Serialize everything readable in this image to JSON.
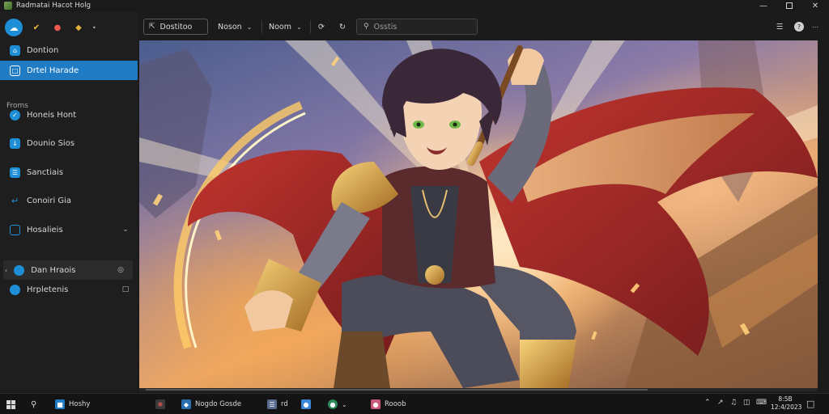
{
  "window": {
    "title": "Radmatai Hacot  Holg"
  },
  "sidebar": {
    "top_items": [
      {
        "label": "Dontion",
        "icon": "home-icon"
      },
      {
        "label": "Drtel Harade",
        "icon": "document-icon",
        "active": true
      }
    ],
    "section_label": "Froms",
    "items": [
      {
        "label": "Honeis Hont",
        "icon": "globe-icon"
      },
      {
        "label": "Dounio Sios",
        "icon": "download-icon"
      },
      {
        "label": "Sanctiais",
        "icon": "list-icon"
      },
      {
        "label": "Conoiri Gia",
        "icon": "share-icon"
      },
      {
        "label": "Hosalieis",
        "icon": "folder-icon",
        "expandable": true
      }
    ],
    "bottom_items": [
      {
        "label": "Dan Hraois",
        "icon": "circle-icon",
        "selected": true
      },
      {
        "label": "Hrpletenis",
        "icon": "circle-icon"
      }
    ]
  },
  "toolbar": {
    "box_label": "Dostitoo",
    "dropdown1": "Noson",
    "dropdown2": "Noom",
    "search_placeholder": "Osstis"
  },
  "taskbar": {
    "items": [
      {
        "label": "Hoshy"
      },
      {
        "label": ""
      },
      {
        "label": "Nogdo Gosde"
      },
      {
        "label": "rd"
      },
      {
        "label": ""
      },
      {
        "label": "Rooob"
      }
    ],
    "clock_line1": "8:5B",
    "clock_line2": "12:4/2023"
  },
  "colors": {
    "accent": "#1e7bc4",
    "sidebar_bg": "#1e1e1e",
    "toolbar_bg": "#1b1b1b"
  }
}
